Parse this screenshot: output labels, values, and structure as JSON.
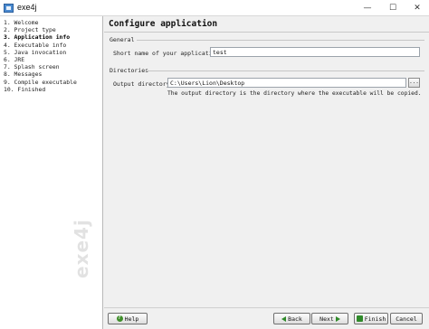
{
  "window": {
    "title": "exe4j",
    "minimize_glyph": "—",
    "maximize_glyph": "☐",
    "close_glyph": "✕"
  },
  "sidebar": {
    "steps": [
      {
        "label": "1. Welcome",
        "active": false
      },
      {
        "label": "2. Project type",
        "active": false
      },
      {
        "label": "3. Application info",
        "active": true
      },
      {
        "label": "4. Executable info",
        "active": false
      },
      {
        "label": "5. Java invocation",
        "active": false
      },
      {
        "label": "6. JRE",
        "active": false
      },
      {
        "label": "7. Splash screen",
        "active": false
      },
      {
        "label": "8. Messages",
        "active": false
      },
      {
        "label": "9. Compile executable",
        "active": false
      },
      {
        "label": "10. Finished",
        "active": false
      }
    ],
    "watermark": "exe4j"
  },
  "main": {
    "title": "Configure application",
    "general": {
      "label": "General",
      "short_name_label": "Short name of your application:",
      "short_name_value": "test"
    },
    "directories": {
      "label": "Directories",
      "output_dir_label": "Output directory:",
      "output_dir_value": "C:\\Users\\Lion\\Desktop",
      "browse_label": "...",
      "hint": "The output directory is the directory where the executable will be copied."
    }
  },
  "buttons": {
    "help": "Help",
    "back": "Back",
    "next": "Next",
    "finish": "Finish",
    "cancel": "Cancel"
  },
  "colors": {
    "accent_green": "#2f8a2a",
    "window_bg": "#f0f0f0"
  },
  "icons": {
    "help": "help-icon",
    "back": "arrow-left-icon",
    "next": "arrow-right-icon",
    "finish": "finish-icon"
  }
}
